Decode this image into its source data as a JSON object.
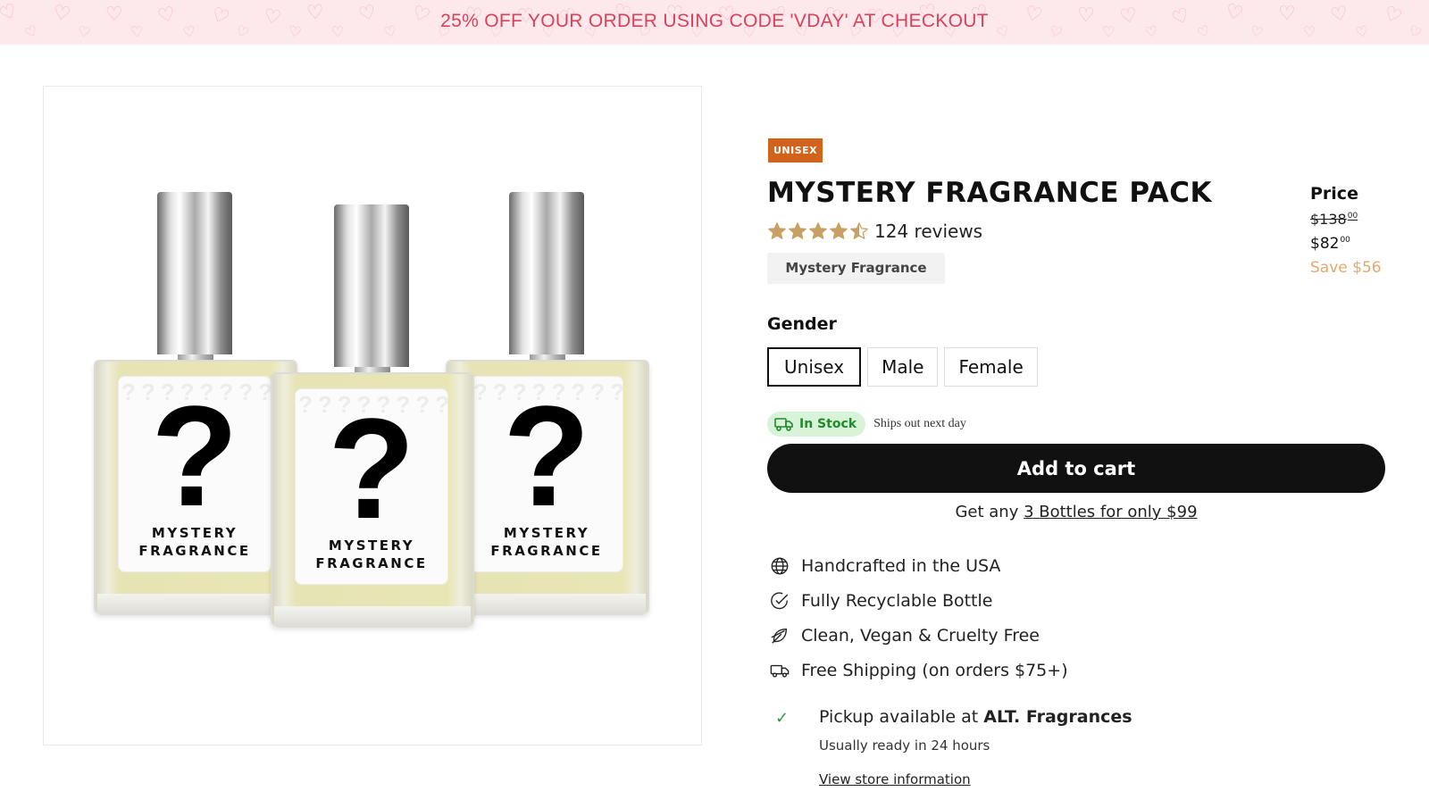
{
  "announcement": {
    "text": "25% OFF YOUR ORDER USING CODE 'VDAY' AT CHECKOUT"
  },
  "product": {
    "badge": "UNISEX",
    "title": "MYSTERY FRAGRANCE PACK",
    "rating": 4.5,
    "reviews_label": "124 reviews",
    "collection_tag": "Mystery Fragrance",
    "image_label": {
      "line1": "MYSTERY",
      "line2": "FRAGRANCE",
      "mark": "?"
    }
  },
  "price": {
    "label": "Price",
    "original_main": "$138",
    "original_cents": "00",
    "current_main": "$82",
    "current_cents": "00",
    "savings": "Save $56"
  },
  "gender": {
    "label": "Gender",
    "options": [
      "Unisex",
      "Male",
      "Female"
    ],
    "selected": "Unisex"
  },
  "stock": {
    "status": "In Stock",
    "shipping_note": "Ships out next day"
  },
  "cart": {
    "button_label": "Add to cart"
  },
  "bundle": {
    "prefix": "Get any ",
    "link_text": "3 Bottles for only $99"
  },
  "features": [
    {
      "icon": "globe-icon",
      "text": "Handcrafted in the USA"
    },
    {
      "icon": "check-circle-icon",
      "text": "Fully Recyclable Bottle"
    },
    {
      "icon": "leaf-icon",
      "text": "Clean, Vegan & Cruelty Free"
    },
    {
      "icon": "truck-icon",
      "text": "Free Shipping (on orders $75+)"
    }
  ],
  "pickup": {
    "prefix": "Pickup available at ",
    "store": "ALT. Fragrances",
    "ready_note": "Usually ready in 24 hours",
    "link_text": "View store information"
  },
  "colors": {
    "announcement_bg": "#fde8ec",
    "announcement_text": "#d8425b",
    "badge_bg": "#d2631c",
    "star": "#c9a063",
    "savings": "#e2a96c",
    "stock_bg": "#d9f3d9",
    "stock_text": "#1f8b2c",
    "button_bg": "#111111"
  }
}
